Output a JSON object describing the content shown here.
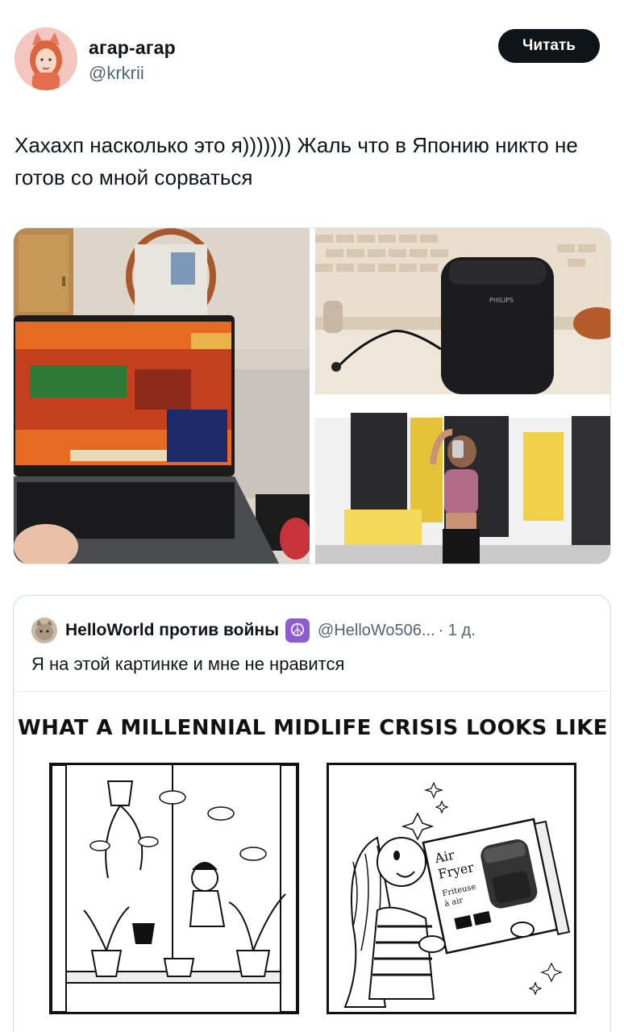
{
  "tweet": {
    "author_name": "агар-агар",
    "author_handle": "@krkrii",
    "follow_label": "Читать",
    "text": "Хахахп насколько это я))))))) Жаль что в Японию никто не готов со мной сорваться"
  },
  "media": [
    {
      "icon": "laptop-game-photo"
    },
    {
      "icon": "air-fryer-photo",
      "brand_text": "PHILIPS"
    },
    {
      "icon": "gym-selfie-photo"
    }
  ],
  "quote": {
    "author_name": "HelloWorld против войны",
    "badge_symbol": "☮",
    "author_handle": "@HelloWo506...",
    "time": "· 1 д.",
    "text": "Я на этой картинке и мне не нравится",
    "comic": {
      "title": "WHAT A MILLENNIAL MIDLIFE CRISIS LOOKS LIKE",
      "box_text_1": "Air",
      "box_text_2": "Fryer",
      "box_text_3": "Friteuse",
      "box_text_4": "à air"
    }
  },
  "colors": {
    "follow_bg": "#0f1419",
    "handle": "#536471",
    "peace_badge": "#8e5bd1"
  }
}
